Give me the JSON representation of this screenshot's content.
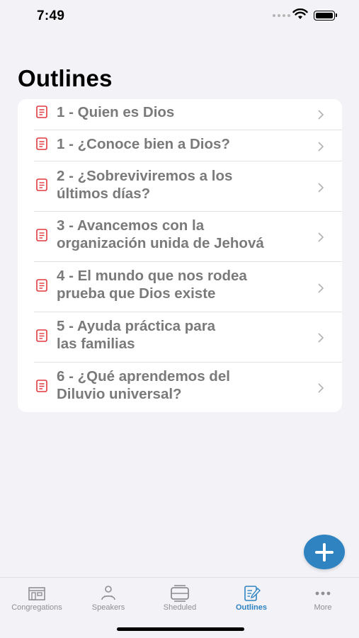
{
  "status": {
    "time": "7:49"
  },
  "page": {
    "title": "Outlines"
  },
  "outlines": [
    {
      "lines": [
        "1 - Quien es Dios"
      ]
    },
    {
      "lines": [
        "1 - ¿Conoce bien a Dios?"
      ]
    },
    {
      "lines": [
        "2 - ¿Sobreviviremos a los",
        "últimos días?"
      ]
    },
    {
      "lines": [
        "3 - Avancemos con la",
        "organización unida de Jehová"
      ]
    },
    {
      "lines": [
        "4 - El mundo que nos rodea",
        "prueba que Dios existe"
      ]
    },
    {
      "lines": [
        "5 - Ayuda práctica para",
        "las familias"
      ]
    },
    {
      "lines": [
        "6 - ¿Qué aprendemos del",
        "Diluvio universal?"
      ]
    }
  ],
  "fab": {
    "icon": "plus-icon"
  },
  "tabs": [
    {
      "label": "Congregations",
      "icon": "building-icon",
      "active": false
    },
    {
      "label": "Speakers",
      "icon": "speaker-icon",
      "active": false
    },
    {
      "label": "Sheduled",
      "icon": "schedule-icon",
      "active": false
    },
    {
      "label": "Outlines",
      "icon": "outline-icon",
      "active": true
    },
    {
      "label": "More",
      "icon": "more-icon",
      "active": false
    }
  ],
  "colors": {
    "accent": "#2f83c1",
    "doc_icon": "#e0393e",
    "row_text": "#7a7a7a",
    "background": "#f2f2f7"
  }
}
